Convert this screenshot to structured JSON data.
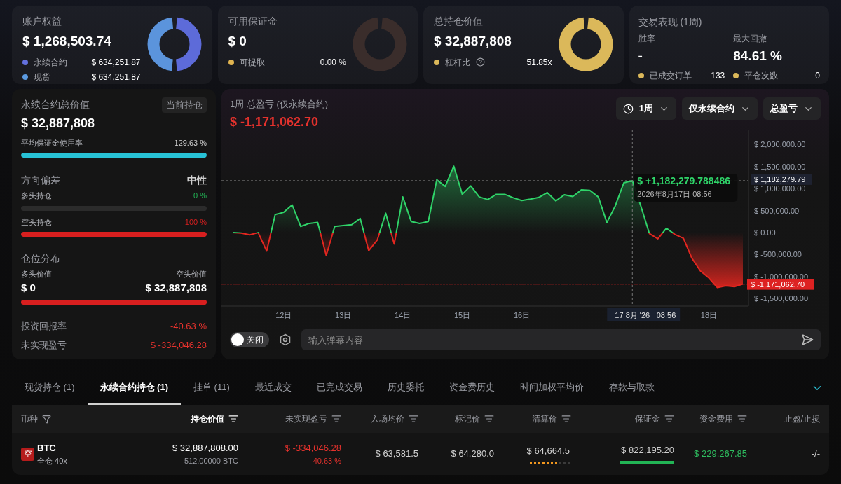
{
  "cards": [
    {
      "title": "账户权益",
      "value": "$ 1,268,503.74",
      "items": [
        {
          "label": "永续合约",
          "value": "$ 634,251.87",
          "color": "#6370dd",
          "help": false
        },
        {
          "label": "现货",
          "value": "$ 634,251.87",
          "color": "#5b9ae0",
          "help": false
        }
      ],
      "ring": {
        "kind": "split",
        "segments": [
          {
            "color": "#5d6bd9",
            "level": 0.5
          },
          {
            "color": "#5b94dc",
            "level": 0.5
          }
        ]
      }
    },
    {
      "title": "可用保证金",
      "value": "$ 0",
      "items": [
        {
          "label": "可提取",
          "value": "0.00 %",
          "color": "#e0b450",
          "help": false
        }
      ],
      "ring": {
        "kind": "empty"
      }
    },
    {
      "title": "总持仓价值",
      "value": "$ 32,887,808",
      "items": [
        {
          "label": "杠杆比",
          "value": "51.85x",
          "color": "#dbb85a",
          "help": true
        }
      ],
      "ring": {
        "kind": "split",
        "segments": [
          {
            "color": "#dbb85a",
            "level": 1
          }
        ]
      }
    }
  ],
  "performance": {
    "title": "交易表现 (1周)",
    "stats": [
      {
        "label": "胜率",
        "value": "-"
      },
      {
        "label": "最大回撤",
        "value": "84.61 %"
      }
    ],
    "counts": [
      {
        "label": "已成交订单",
        "value": "133",
        "color": "#dbb85a"
      },
      {
        "label": "平仓次数",
        "value": "0",
        "color": "#dbb85a"
      }
    ]
  },
  "perp_summary": {
    "title": "永续合约总价值",
    "badge": "当前持仓",
    "value": "$ 32,887,808",
    "margin_usage": {
      "label": "平均保证金使用率",
      "reading": "129.63 %",
      "level": 1
    },
    "bias": {
      "title": "方向偏差",
      "value": "中性",
      "rows": [
        {
          "label": "多头持仓",
          "reading": "0 %",
          "kind": "long"
        },
        {
          "label": "空头持仓",
          "reading": "100 %",
          "level": 1,
          "kind": "short"
        }
      ]
    },
    "distribution": {
      "title": "仓位分布",
      "long_label": "多头价值",
      "short_label": "空头价值",
      "long_value": "$ 0",
      "short_value": "$ 32,887,808"
    },
    "metrics": [
      {
        "label": "投资回报率",
        "value": "-40.63 %"
      },
      {
        "label": "未实现盈亏",
        "value": "$ -334,046.28"
      }
    ]
  },
  "chart_panel": {
    "title": "1周 总盈亏 (仅永续合约)",
    "total": "$ -1,171,062.70",
    "filters": [
      {
        "label": "1周",
        "kind": "time"
      },
      {
        "label": "仅永续合约",
        "kind": "plain"
      },
      {
        "label": "总盈亏",
        "kind": "plain"
      }
    ],
    "chart_data": {
      "type": "area",
      "categories": [
        null,
        null,
        null,
        null,
        null,
        null,
        "12日",
        null,
        null,
        null,
        null,
        null,
        null,
        "13日",
        null,
        null,
        null,
        null,
        null,
        null,
        "14日",
        null,
        null,
        null,
        null,
        null,
        null,
        "15日",
        null,
        null,
        null,
        null,
        null,
        null,
        "16日",
        null,
        null,
        null,
        null,
        null,
        null,
        null,
        null,
        null,
        null,
        null,
        null,
        "17 8月 '26",
        null,
        null,
        null,
        null,
        null,
        null,
        null,
        null,
        "18日",
        null,
        null,
        null,
        null
      ],
      "ylim": [
        -1670000,
        2340000
      ],
      "values": [
        0,
        -10000,
        -50000,
        0,
        -420000,
        410000,
        460000,
        630000,
        140000,
        210000,
        230000,
        -520000,
        140000,
        160000,
        180000,
        320000,
        -410000,
        -170000,
        440000,
        -260000,
        810000,
        250000,
        210000,
        250000,
        1200000,
        1050000,
        1510000,
        870000,
        1060000,
        810000,
        750000,
        870000,
        870000,
        790000,
        730000,
        760000,
        800000,
        910000,
        720000,
        860000,
        820000,
        970000,
        960000,
        810000,
        230000,
        610000,
        1130000,
        1180000,
        600000,
        -20000,
        -140000,
        100000,
        -40000,
        -130000,
        -580000,
        -870000,
        -1030000,
        -1250000,
        -1210000,
        -1230000,
        -1170000
      ],
      "yticks": [
        {
          "value": 2000000,
          "label": "$ 2,000,000.00"
        },
        {
          "value": 1500000,
          "label": "$ 1,500,000.00"
        },
        {
          "value": 1000000,
          "label": "$ 1,000,000.00"
        },
        {
          "value": 500000,
          "label": "$ 500,000.00"
        },
        {
          "value": 0,
          "label": "$ 0.00"
        },
        {
          "value": -500000,
          "label": "$ -500,000.00"
        },
        {
          "value": -1000000,
          "label": "$ -1,000,000.00"
        },
        {
          "value": -1500000,
          "label": "$ -1,500,000.00"
        }
      ],
      "ref_lines": [
        {
          "axis": "y",
          "value": -1171062.7,
          "label": "$ -1,171,062.70"
        }
      ],
      "annotations": [
        {
          "x": "17 8月 '26",
          "y": 1180000,
          "text": "$ +1,182,279.788486"
        }
      ]
    },
    "crosshair": {
      "date": "2026年8月17日 08:56",
      "axis_time": "08:56",
      "price_tag": "$ 1,182,279.79"
    },
    "danmaku": {
      "toggle": {
        "label": "关闭",
        "on": false
      },
      "placeholder": "输入弹幕内容"
    }
  },
  "tabs": [
    {
      "label": "现货持仓 (1)",
      "selected": false
    },
    {
      "label": "永续合约持仓 (1)",
      "selected": true
    },
    {
      "label": "挂单 (11)",
      "selected": false
    },
    {
      "label": "最近成交",
      "selected": false
    },
    {
      "label": "已完成交易",
      "selected": false
    },
    {
      "label": "历史委托",
      "selected": false
    },
    {
      "label": "资金费历史",
      "selected": false
    },
    {
      "label": "时间加权平均价",
      "selected": false
    },
    {
      "label": "存款与取款",
      "selected": false
    }
  ],
  "table": {
    "columns": [
      {
        "label": "币种",
        "kind": "filter",
        "sorted": false
      },
      {
        "label": "持仓价值",
        "kind": "sort",
        "sorted": true
      },
      {
        "label": "未实现盈亏",
        "kind": "sort",
        "sorted": false
      },
      {
        "label": "入场均价",
        "kind": "sort",
        "sorted": false
      },
      {
        "label": "标记价",
        "kind": "sort",
        "sorted": false
      },
      {
        "label": "清算价",
        "kind": "sort",
        "sorted": false
      },
      {
        "label": "保证金",
        "kind": "sort",
        "sorted": false
      },
      {
        "label": "资金费用",
        "kind": "sort",
        "sorted": false
      },
      {
        "label": "止盈/止损",
        "kind": "plain",
        "sorted": false
      }
    ],
    "rows": [
      {
        "side": "空",
        "symbol": "BTC",
        "margin_mode": "全仓 40x",
        "position_value": "$ 32,887,808.00",
        "size": "-512.00000 BTC",
        "pnl": "$ -334,046.28",
        "pnl_pct": "-40.63 %",
        "entry": "$ 63,581.5",
        "mark": "$ 64,280.0",
        "liquidation": {
          "value": "$ 64,664.5",
          "level": 0.7
        },
        "margin": {
          "value": "$ 822,195.20",
          "level": 1
        },
        "funding": "$ 229,267.85",
        "tpsl": "-/-"
      }
    ]
  }
}
